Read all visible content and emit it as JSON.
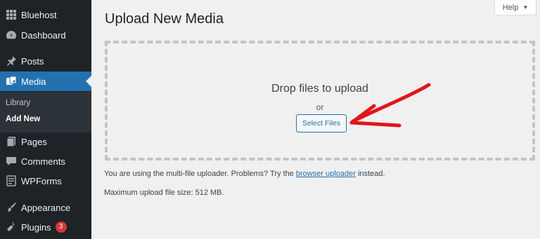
{
  "sidebar": {
    "items": [
      {
        "label": "Bluehost",
        "icon": "grid-icon"
      },
      {
        "label": "Dashboard",
        "icon": "dashboard-icon"
      },
      {
        "label": "Posts",
        "icon": "pin-icon"
      },
      {
        "label": "Media",
        "icon": "media-icon",
        "active": true
      },
      {
        "label": "Pages",
        "icon": "pages-icon"
      },
      {
        "label": "Comments",
        "icon": "comment-icon"
      },
      {
        "label": "WPForms",
        "icon": "wpforms-icon"
      },
      {
        "label": "Appearance",
        "icon": "brush-icon"
      },
      {
        "label": "Plugins",
        "icon": "plugin-icon",
        "badge": "3"
      }
    ],
    "submenu": [
      {
        "label": "Library"
      },
      {
        "label": "Add New",
        "current": true
      }
    ]
  },
  "header": {
    "title": "Upload New Media",
    "help_label": "Help"
  },
  "uploader": {
    "drop_text": "Drop files to upload",
    "or_text": "or",
    "select_label": "Select Files"
  },
  "info": {
    "line1_before": "You are using the multi-file uploader. Problems? Try the ",
    "line1_link": "browser uploader",
    "line1_after": " instead.",
    "line2": "Maximum upload file size: 512 MB."
  },
  "colors": {
    "sidebar_bg": "#1d2327",
    "active_bg": "#2271b1",
    "badge": "#d63638",
    "arrow": "#e3151a"
  }
}
